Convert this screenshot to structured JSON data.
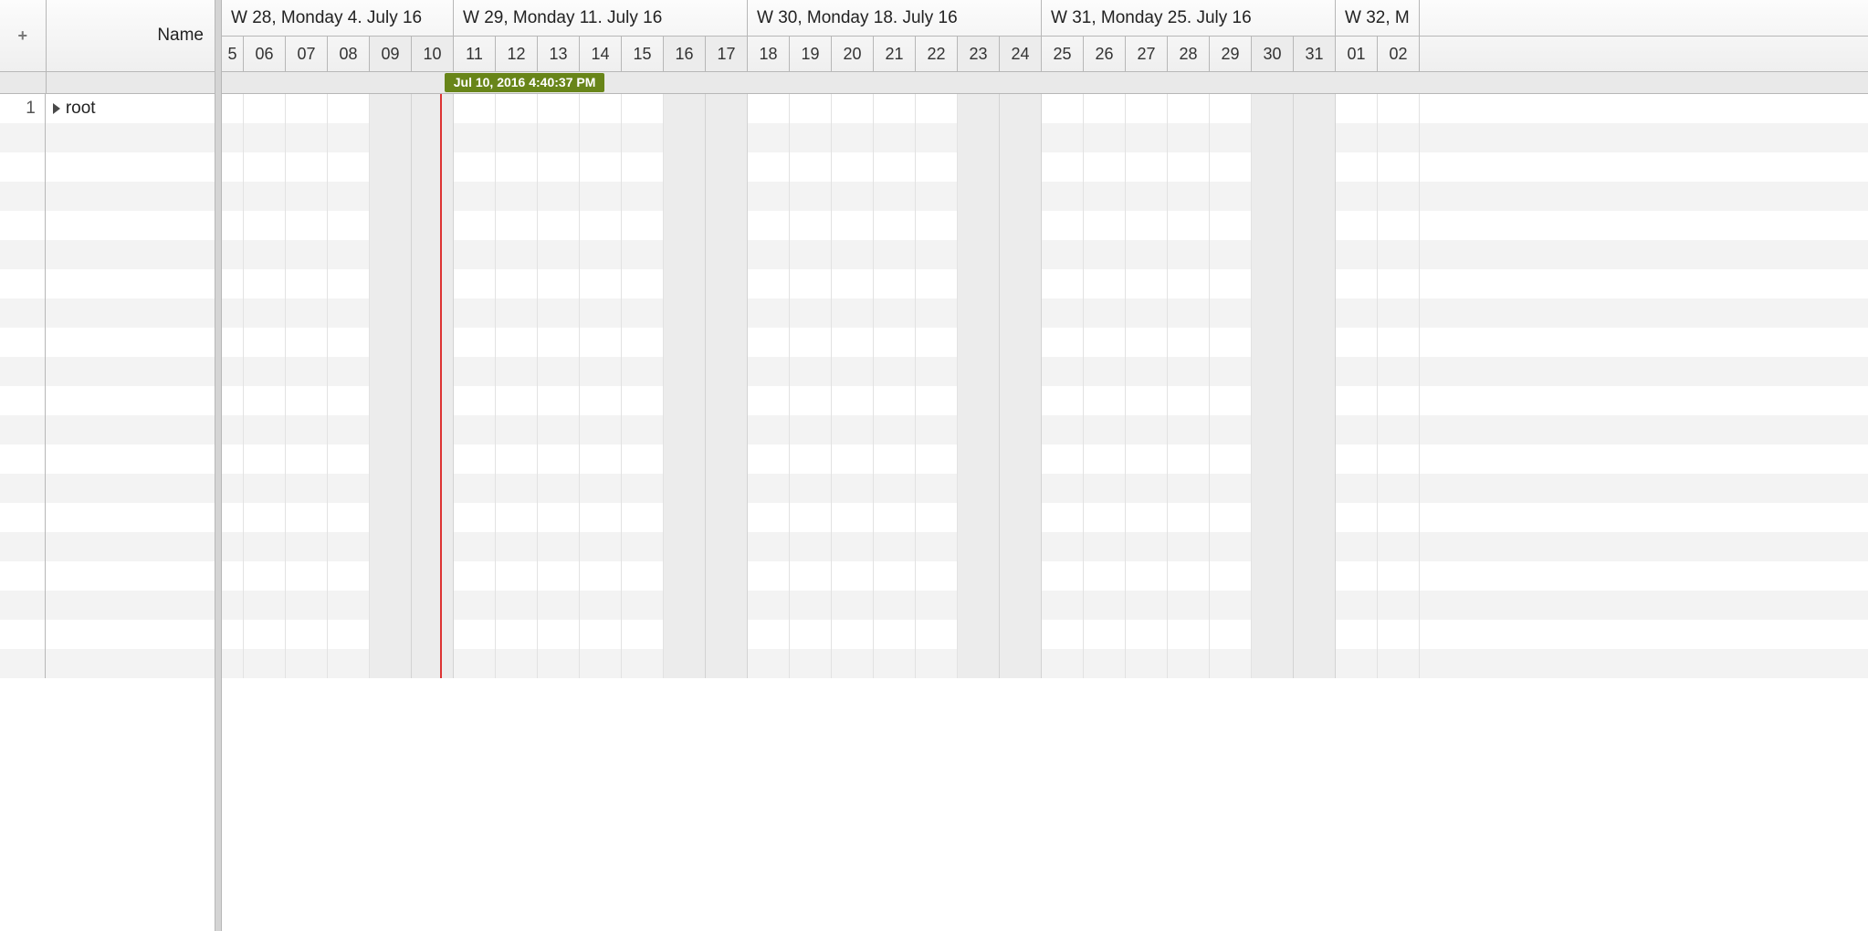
{
  "left": {
    "plus_label": "+",
    "name_header": "Name",
    "rows": [
      {
        "num": "1",
        "name": "root",
        "has_children": true
      }
    ],
    "empty_row_count": 19
  },
  "timeline": {
    "weeks": [
      {
        "label": "W 28, Monday 4. July 16",
        "days": [
          "5",
          "06",
          "07",
          "08",
          "09",
          "10"
        ],
        "start_index": 0,
        "weekend_days": [
          "09",
          "10"
        ],
        "first_partial": true
      },
      {
        "label": "W 29, Monday 11. July 16",
        "days": [
          "11",
          "12",
          "13",
          "14",
          "15",
          "16",
          "17"
        ],
        "weekend_days": [
          "16",
          "17"
        ]
      },
      {
        "label": "W 30, Monday 18. July 16",
        "days": [
          "18",
          "19",
          "20",
          "21",
          "22",
          "23",
          "24"
        ],
        "weekend_days": [
          "23",
          "24"
        ]
      },
      {
        "label": "W 31, Monday 25. July 16",
        "days": [
          "25",
          "26",
          "27",
          "28",
          "29",
          "30",
          "31"
        ],
        "weekend_days": [
          "30",
          "31"
        ]
      },
      {
        "label": "W 32, M",
        "days": [
          "01",
          "02"
        ],
        "weekend_days": [],
        "cut_off": true
      }
    ],
    "now_marker": {
      "label": "Jul 10, 2016 4:40:37 PM",
      "day_index": 5,
      "fraction": 0.69
    },
    "body_row_count": 20
  },
  "colors": {
    "tooltip_bg": "#688519",
    "now_line": "#d33"
  }
}
